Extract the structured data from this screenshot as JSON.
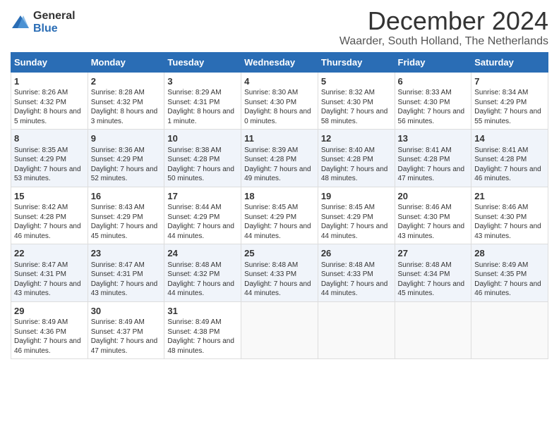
{
  "logo": {
    "general": "General",
    "blue": "Blue"
  },
  "title": "December 2024",
  "location": "Waarder, South Holland, The Netherlands",
  "days_of_week": [
    "Sunday",
    "Monday",
    "Tuesday",
    "Wednesday",
    "Thursday",
    "Friday",
    "Saturday"
  ],
  "weeks": [
    [
      {
        "day": "1",
        "sunrise": "Sunrise: 8:26 AM",
        "sunset": "Sunset: 4:32 PM",
        "daylight": "Daylight: 8 hours and 5 minutes."
      },
      {
        "day": "2",
        "sunrise": "Sunrise: 8:28 AM",
        "sunset": "Sunset: 4:32 PM",
        "daylight": "Daylight: 8 hours and 3 minutes."
      },
      {
        "day": "3",
        "sunrise": "Sunrise: 8:29 AM",
        "sunset": "Sunset: 4:31 PM",
        "daylight": "Daylight: 8 hours and 1 minute."
      },
      {
        "day": "4",
        "sunrise": "Sunrise: 8:30 AM",
        "sunset": "Sunset: 4:30 PM",
        "daylight": "Daylight: 8 hours and 0 minutes."
      },
      {
        "day": "5",
        "sunrise": "Sunrise: 8:32 AM",
        "sunset": "Sunset: 4:30 PM",
        "daylight": "Daylight: 7 hours and 58 minutes."
      },
      {
        "day": "6",
        "sunrise": "Sunrise: 8:33 AM",
        "sunset": "Sunset: 4:30 PM",
        "daylight": "Daylight: 7 hours and 56 minutes."
      },
      {
        "day": "7",
        "sunrise": "Sunrise: 8:34 AM",
        "sunset": "Sunset: 4:29 PM",
        "daylight": "Daylight: 7 hours and 55 minutes."
      }
    ],
    [
      {
        "day": "8",
        "sunrise": "Sunrise: 8:35 AM",
        "sunset": "Sunset: 4:29 PM",
        "daylight": "Daylight: 7 hours and 53 minutes."
      },
      {
        "day": "9",
        "sunrise": "Sunrise: 8:36 AM",
        "sunset": "Sunset: 4:29 PM",
        "daylight": "Daylight: 7 hours and 52 minutes."
      },
      {
        "day": "10",
        "sunrise": "Sunrise: 8:38 AM",
        "sunset": "Sunset: 4:28 PM",
        "daylight": "Daylight: 7 hours and 50 minutes."
      },
      {
        "day": "11",
        "sunrise": "Sunrise: 8:39 AM",
        "sunset": "Sunset: 4:28 PM",
        "daylight": "Daylight: 7 hours and 49 minutes."
      },
      {
        "day": "12",
        "sunrise": "Sunrise: 8:40 AM",
        "sunset": "Sunset: 4:28 PM",
        "daylight": "Daylight: 7 hours and 48 minutes."
      },
      {
        "day": "13",
        "sunrise": "Sunrise: 8:41 AM",
        "sunset": "Sunset: 4:28 PM",
        "daylight": "Daylight: 7 hours and 47 minutes."
      },
      {
        "day": "14",
        "sunrise": "Sunrise: 8:41 AM",
        "sunset": "Sunset: 4:28 PM",
        "daylight": "Daylight: 7 hours and 46 minutes."
      }
    ],
    [
      {
        "day": "15",
        "sunrise": "Sunrise: 8:42 AM",
        "sunset": "Sunset: 4:28 PM",
        "daylight": "Daylight: 7 hours and 46 minutes."
      },
      {
        "day": "16",
        "sunrise": "Sunrise: 8:43 AM",
        "sunset": "Sunset: 4:29 PM",
        "daylight": "Daylight: 7 hours and 45 minutes."
      },
      {
        "day": "17",
        "sunrise": "Sunrise: 8:44 AM",
        "sunset": "Sunset: 4:29 PM",
        "daylight": "Daylight: 7 hours and 44 minutes."
      },
      {
        "day": "18",
        "sunrise": "Sunrise: 8:45 AM",
        "sunset": "Sunset: 4:29 PM",
        "daylight": "Daylight: 7 hours and 44 minutes."
      },
      {
        "day": "19",
        "sunrise": "Sunrise: 8:45 AM",
        "sunset": "Sunset: 4:29 PM",
        "daylight": "Daylight: 7 hours and 44 minutes."
      },
      {
        "day": "20",
        "sunrise": "Sunrise: 8:46 AM",
        "sunset": "Sunset: 4:30 PM",
        "daylight": "Daylight: 7 hours and 43 minutes."
      },
      {
        "day": "21",
        "sunrise": "Sunrise: 8:46 AM",
        "sunset": "Sunset: 4:30 PM",
        "daylight": "Daylight: 7 hours and 43 minutes."
      }
    ],
    [
      {
        "day": "22",
        "sunrise": "Sunrise: 8:47 AM",
        "sunset": "Sunset: 4:31 PM",
        "daylight": "Daylight: 7 hours and 43 minutes."
      },
      {
        "day": "23",
        "sunrise": "Sunrise: 8:47 AM",
        "sunset": "Sunset: 4:31 PM",
        "daylight": "Daylight: 7 hours and 43 minutes."
      },
      {
        "day": "24",
        "sunrise": "Sunrise: 8:48 AM",
        "sunset": "Sunset: 4:32 PM",
        "daylight": "Daylight: 7 hours and 44 minutes."
      },
      {
        "day": "25",
        "sunrise": "Sunrise: 8:48 AM",
        "sunset": "Sunset: 4:33 PM",
        "daylight": "Daylight: 7 hours and 44 minutes."
      },
      {
        "day": "26",
        "sunrise": "Sunrise: 8:48 AM",
        "sunset": "Sunset: 4:33 PM",
        "daylight": "Daylight: 7 hours and 44 minutes."
      },
      {
        "day": "27",
        "sunrise": "Sunrise: 8:48 AM",
        "sunset": "Sunset: 4:34 PM",
        "daylight": "Daylight: 7 hours and 45 minutes."
      },
      {
        "day": "28",
        "sunrise": "Sunrise: 8:49 AM",
        "sunset": "Sunset: 4:35 PM",
        "daylight": "Daylight: 7 hours and 46 minutes."
      }
    ],
    [
      {
        "day": "29",
        "sunrise": "Sunrise: 8:49 AM",
        "sunset": "Sunset: 4:36 PM",
        "daylight": "Daylight: 7 hours and 46 minutes."
      },
      {
        "day": "30",
        "sunrise": "Sunrise: 8:49 AM",
        "sunset": "Sunset: 4:37 PM",
        "daylight": "Daylight: 7 hours and 47 minutes."
      },
      {
        "day": "31",
        "sunrise": "Sunrise: 8:49 AM",
        "sunset": "Sunset: 4:38 PM",
        "daylight": "Daylight: 7 hours and 48 minutes."
      },
      null,
      null,
      null,
      null
    ]
  ]
}
